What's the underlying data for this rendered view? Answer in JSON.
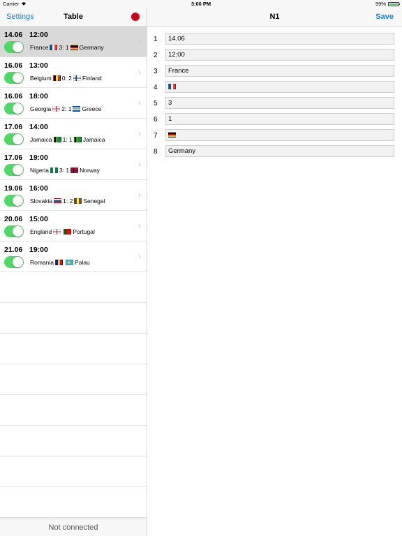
{
  "status": {
    "carrier": "Carrier",
    "time": "3:00 PM",
    "battery": "99%"
  },
  "master": {
    "settings_label": "Settings",
    "title": "Table",
    "footer": "Not connected",
    "rows": [
      {
        "date": "14.06",
        "time": "12:00",
        "home": "France",
        "home_flag": "flag-fr",
        "score": "3: 1",
        "away": "Germany",
        "away_flag": "flag-de",
        "selected": true
      },
      {
        "date": "16.06",
        "time": "13:00",
        "home": "Belgium",
        "home_flag": "flag-be",
        "score": "0: 2",
        "away": "Finland",
        "away_flag": "flag-fi"
      },
      {
        "date": "16.06",
        "time": "18:00",
        "home": "Georgia",
        "home_flag": "flag-ge",
        "score": "2: 1",
        "away": "Greece",
        "away_flag": "flag-gr"
      },
      {
        "date": "17.06",
        "time": "14:00",
        "home": "Jamaica",
        "home_flag": "flag-jm",
        "score": "1: 1",
        "away": "Jamaica",
        "away_flag": "flag-jm"
      },
      {
        "date": "17.06",
        "time": "19:00",
        "home": "Nigeria",
        "home_flag": "flag-ng",
        "score": "3: 1",
        "away": "Norway",
        "away_flag": "flag-no"
      },
      {
        "date": "19.06",
        "time": "16:00",
        "home": "Slovakia",
        "home_flag": "flag-sk",
        "score": "1: 2",
        "away": "Senegal",
        "away_flag": "flag-sn"
      },
      {
        "date": "20.06",
        "time": "15:00",
        "home": "England",
        "home_flag": "flag-gb-eng",
        "score": "",
        "away": "Portugal",
        "away_flag": "flag-pt"
      },
      {
        "date": "21.06",
        "time": "19:00",
        "home": "Romania",
        "home_flag": "flag-ro",
        "score": "",
        "away": "Palau",
        "away_flag": "flag-pw"
      }
    ]
  },
  "detail": {
    "title": "N1",
    "save_label": "Save",
    "fields": [
      {
        "n": "1",
        "value": "14.06"
      },
      {
        "n": "2",
        "value": "12:00"
      },
      {
        "n": "3",
        "value": "France"
      },
      {
        "n": "4",
        "value": "",
        "flag": "flag-fr"
      },
      {
        "n": "5",
        "value": "3"
      },
      {
        "n": "6",
        "value": "1"
      },
      {
        "n": "7",
        "value": "",
        "flag": "flag-de"
      },
      {
        "n": "8",
        "value": "Germany"
      }
    ]
  },
  "colors": {
    "accent": "#1a7ff2",
    "toggle_on": "#4cd964",
    "record": "#d0021b"
  }
}
